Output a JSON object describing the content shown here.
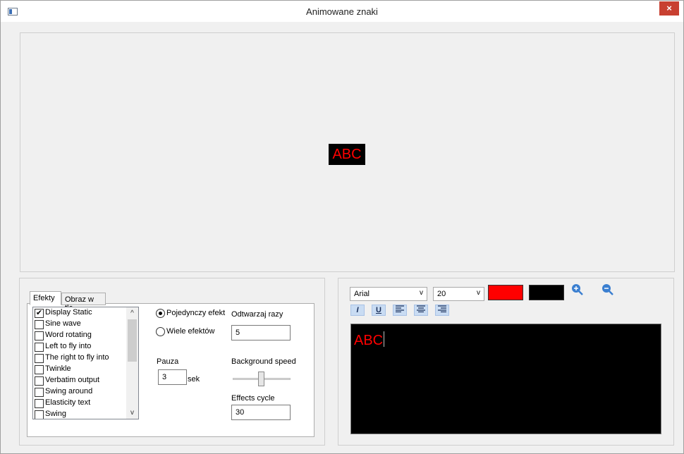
{
  "window": {
    "title": "Animowane znaki",
    "close_glyph": "×"
  },
  "preview": {
    "text": "ABC",
    "text_color": "#ff0000",
    "bg_color": "#000000"
  },
  "tabs": [
    {
      "label": "Efekty",
      "active": true
    },
    {
      "label": "Obraz w tle",
      "active": false
    }
  ],
  "effects": [
    {
      "label": "Display Static",
      "checked": true
    },
    {
      "label": "Sine wave",
      "checked": false
    },
    {
      "label": "Word rotating",
      "checked": false
    },
    {
      "label": "Left to fly into",
      "checked": false
    },
    {
      "label": "The right to fly into",
      "checked": false
    },
    {
      "label": "Twinkle",
      "checked": false
    },
    {
      "label": "Verbatim output",
      "checked": false
    },
    {
      "label": "Swing around",
      "checked": false
    },
    {
      "label": "Elasticity text",
      "checked": false
    },
    {
      "label": "Swing",
      "checked": false
    }
  ],
  "mode": {
    "single_label": "Pojedynczy efekt",
    "multi_label": "Wiele efektów",
    "selected": "single"
  },
  "repeat": {
    "label": "Odtwarzaj razy",
    "value": "5"
  },
  "pause": {
    "label": "Pauza",
    "value": "3",
    "unit": "sek"
  },
  "background_speed": {
    "label": "Background speed",
    "level": 0.5
  },
  "effects_cycle": {
    "label": "Effects cycle",
    "value": "30"
  },
  "format": {
    "font": "Arial",
    "size": "20",
    "text_color": "#ff0000",
    "bg_color": "#000000",
    "italic_label": "I",
    "underline_label": "U"
  },
  "editor": {
    "text": "ABC"
  }
}
